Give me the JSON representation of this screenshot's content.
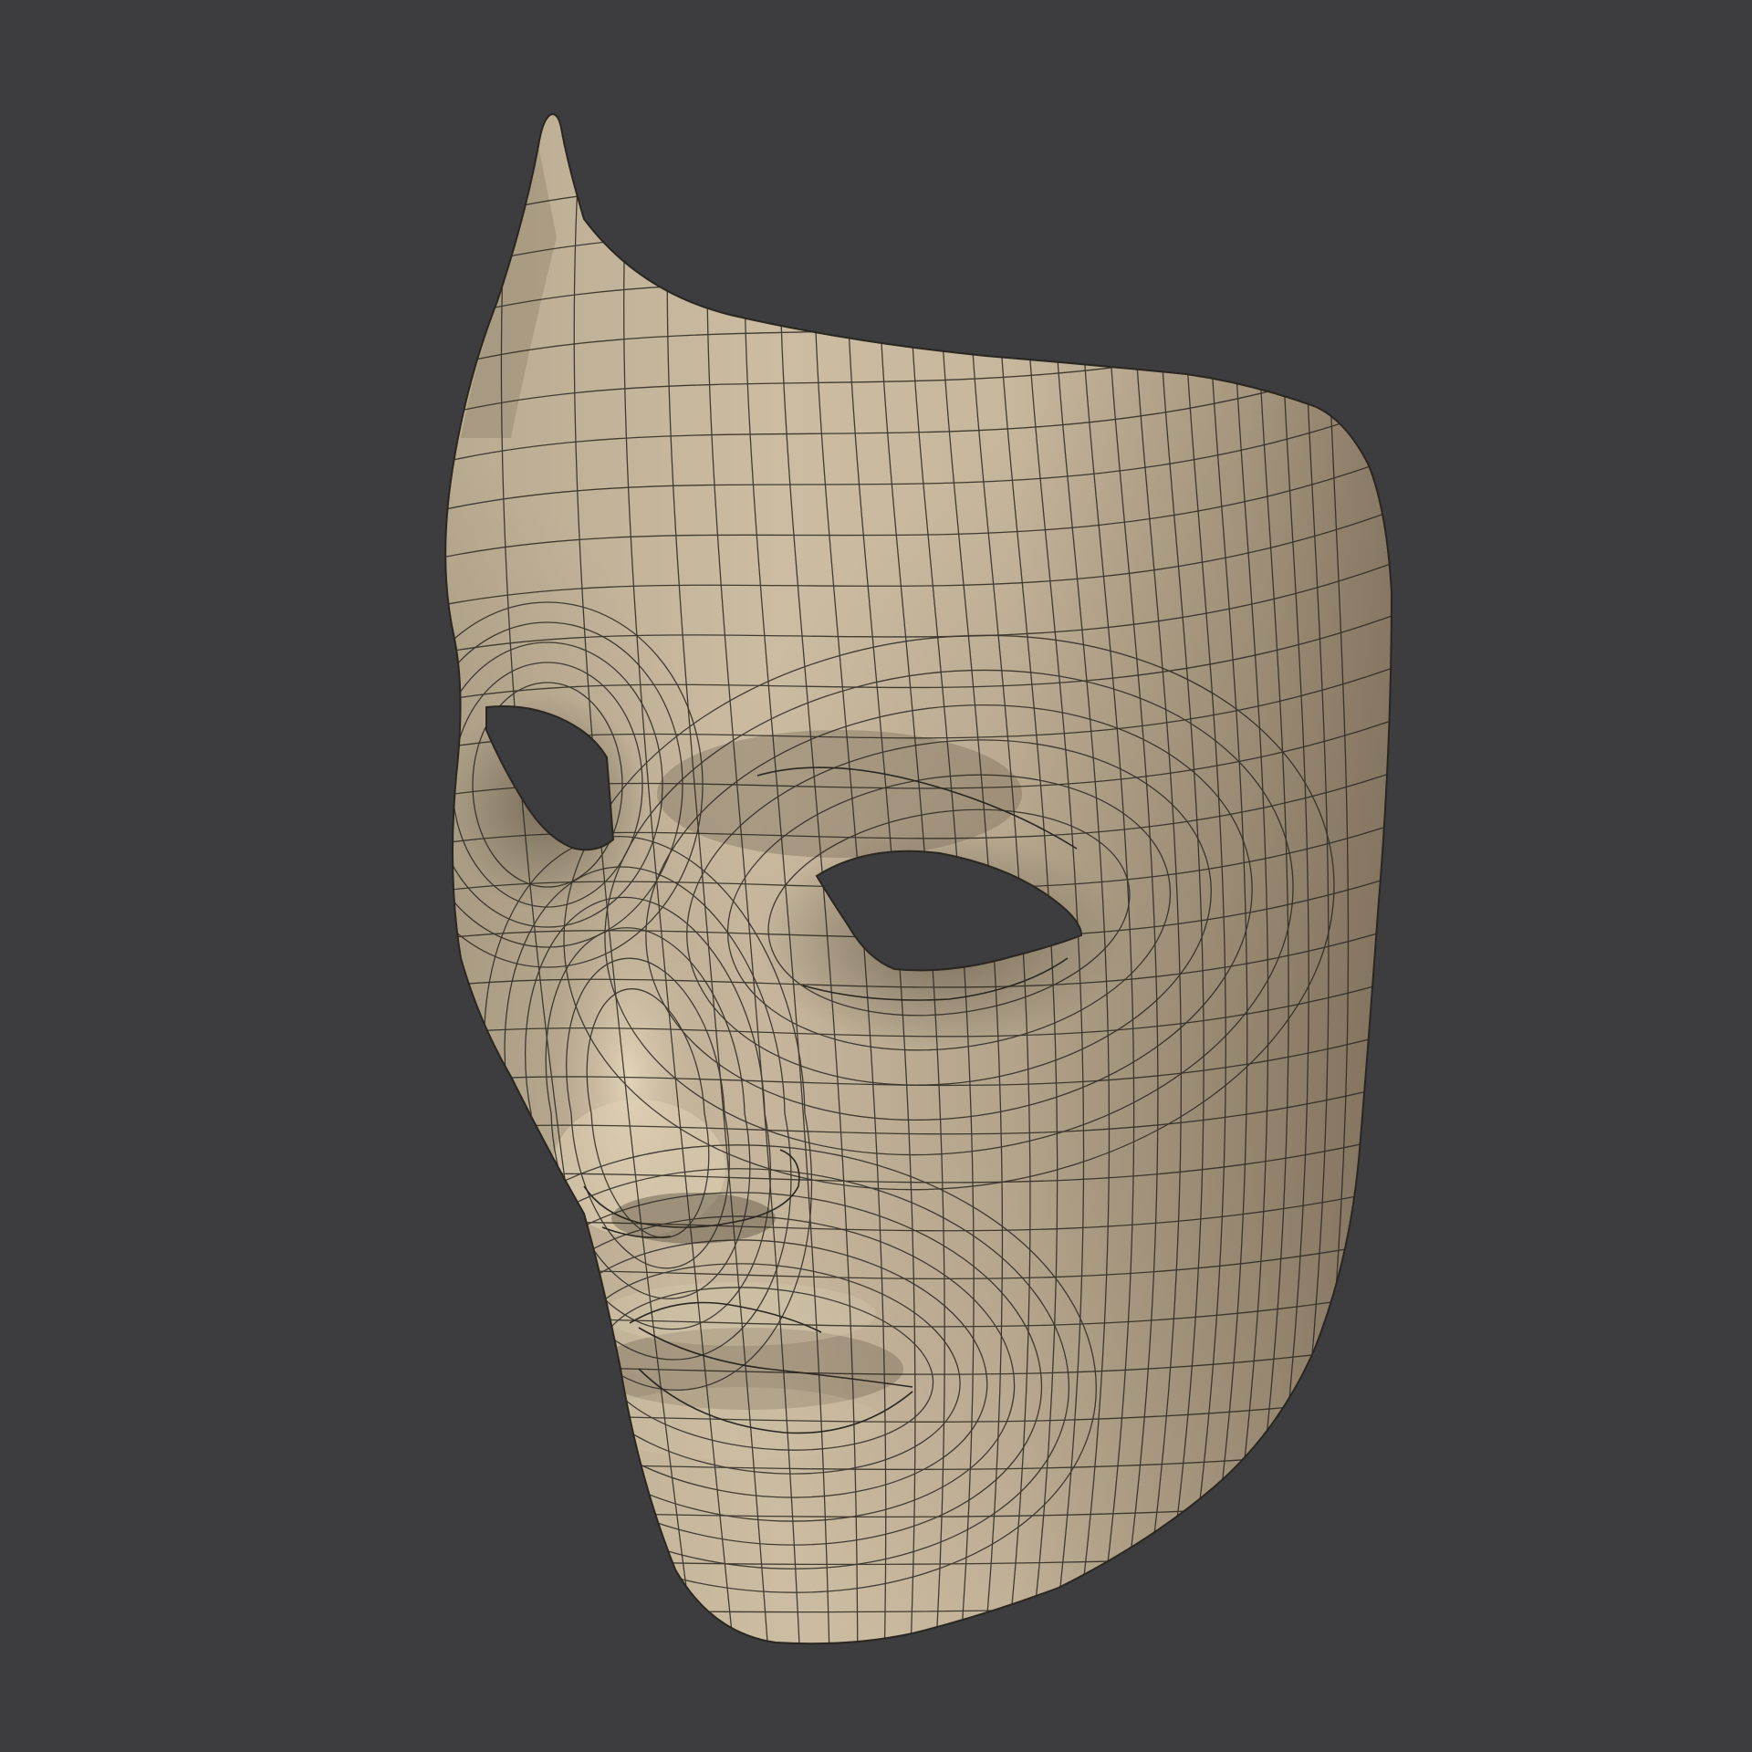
{
  "viewport": {
    "background_color": "#3d3d3f",
    "object": "face-mask",
    "display_mode": "wireframe-on-shaded",
    "colors": {
      "surface_light": "#d6c7ad",
      "surface_mid": "#b4a58c",
      "surface_dark": "#6e604f",
      "wire": "#2a2620",
      "hole": "#3d3d3f"
    }
  }
}
